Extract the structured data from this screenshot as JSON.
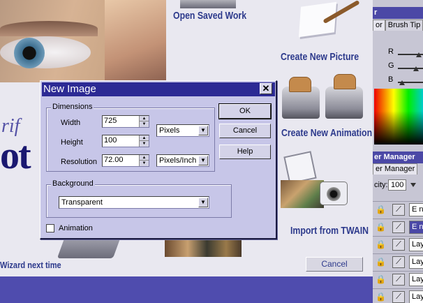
{
  "wizard": {
    "options": [
      {
        "label": "Open Saved Work",
        "icon": "folder-icon"
      },
      {
        "label": "Create New Picture",
        "icon": "paper-pencil-icon"
      },
      {
        "label": "Create New Animation",
        "icon": "toaster-icon"
      },
      {
        "label": "Import from TWAIN",
        "icon": "camera-icon"
      }
    ],
    "brand_small": "rif",
    "brand_big": "ot",
    "footer_text": "Wizard next time",
    "cancel_label": "Cancel"
  },
  "palettes": {
    "color_title": "r",
    "color_tabs": [
      "or",
      "Brush Tip"
    ],
    "rgb_labels": [
      "R",
      "G",
      "B"
    ],
    "layer_title": "er Manager",
    "layer_tab": "er Manager",
    "opacity_label": "city:",
    "opacity_value": "100",
    "layers": [
      {
        "name": "E n",
        "selected": false
      },
      {
        "name": "E n",
        "selected": true
      },
      {
        "name": "Lay",
        "selected": false
      },
      {
        "name": "Lay",
        "selected": false
      },
      {
        "name": "Lay",
        "selected": false
      },
      {
        "name": "Lay",
        "selected": false
      }
    ]
  },
  "dialog": {
    "title": "New Image",
    "close_glyph": "✕",
    "dimensions": {
      "group_label": "Dimensions",
      "width_label": "Width",
      "width_value": "725",
      "height_label": "Height",
      "height_value": "100",
      "resolution_label": "Resolution",
      "resolution_value": "72.00",
      "size_unit": "Pixels",
      "resolution_unit": "Pixels/Inch"
    },
    "background": {
      "group_label": "Background",
      "value": "Transparent"
    },
    "animation_label": "Animation",
    "animation_checked": false,
    "buttons": {
      "ok": "OK",
      "cancel": "Cancel",
      "help": "Help"
    }
  },
  "colors": {
    "title_bar": "#2c2a94",
    "dialog_bg": "#c7c6e8",
    "wizard_text": "#2d3a8c",
    "band": "#4f4cae"
  }
}
